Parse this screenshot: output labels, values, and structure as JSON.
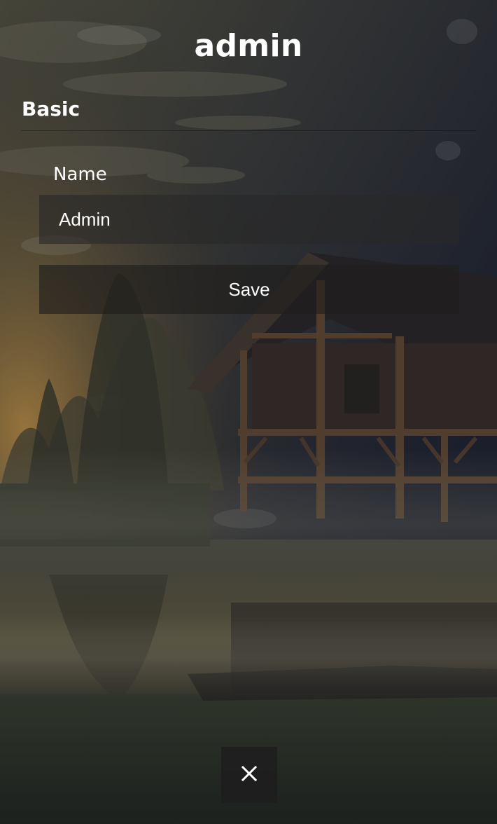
{
  "header": {
    "title": "admin"
  },
  "section": {
    "title": "Basic"
  },
  "form": {
    "name_label": "Name",
    "name_value": "Admin",
    "save_label": "Save"
  },
  "actions": {
    "close_icon": "close-icon"
  },
  "colors": {
    "text": "#ffffff",
    "input_background": "#282828",
    "button_background": "#201e1c",
    "close_background": "#1c1c1c"
  }
}
